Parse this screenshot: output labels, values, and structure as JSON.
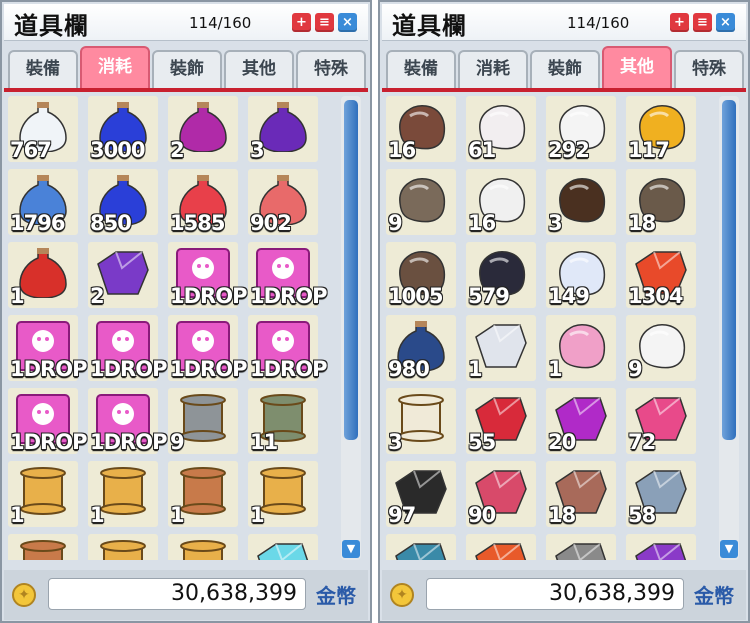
{
  "title": "道具欄",
  "capacity": "114/160",
  "buttons": {
    "add": "+",
    "menu": "≡",
    "close": "×",
    "scroll_down": "▼"
  },
  "tabs": [
    "裝備",
    "消耗",
    "裝飾",
    "其他",
    "特殊"
  ],
  "money": "30,638,399",
  "currency": "金幣",
  "left_active_tab": 1,
  "right_active_tab": 3,
  "left_items": [
    {
      "qty": "767",
      "icon": "white-potion",
      "color": "#f0f4f8"
    },
    {
      "qty": "3000",
      "icon": "blue-potion",
      "color": "#2a3fd8"
    },
    {
      "qty": "2",
      "icon": "purple-potion",
      "color": "#b02aa8"
    },
    {
      "qty": "3",
      "icon": "violet-potion",
      "color": "#6a2ab8"
    },
    {
      "qty": "1796",
      "icon": "blue-elixir",
      "color": "#4a82d8"
    },
    {
      "qty": "850",
      "icon": "blue-elixir",
      "color": "#2a3fd8"
    },
    {
      "qty": "1585",
      "icon": "red-elixir",
      "color": "#e8404a"
    },
    {
      "qty": "902",
      "icon": "red-elixir",
      "color": "#e86a6a"
    },
    {
      "qty": "1",
      "icon": "red-vial",
      "color": "#d8302a"
    },
    {
      "qty": "2",
      "icon": "crystal-orb",
      "color": "#7a3ac8"
    },
    {
      "qty": "1DROP",
      "icon": "drop-card",
      "color": "#e85ac8"
    },
    {
      "qty": "1DROP",
      "icon": "drop-card",
      "color": "#e85ac8"
    },
    {
      "qty": "1DROP",
      "icon": "drop-card",
      "color": "#e85ac8"
    },
    {
      "qty": "1DROP",
      "icon": "drop-card",
      "color": "#e85ac8"
    },
    {
      "qty": "1DROP",
      "icon": "drop-card",
      "color": "#e85ac8"
    },
    {
      "qty": "1DROP",
      "icon": "drop-card",
      "color": "#e85ac8"
    },
    {
      "qty": "1DROP",
      "icon": "drop-card",
      "color": "#e85ac8"
    },
    {
      "qty": "1DROP",
      "icon": "drop-card",
      "color": "#e85ac8"
    },
    {
      "qty": "9",
      "icon": "gray-map",
      "color": "#8e9498"
    },
    {
      "qty": "11",
      "icon": "green-map",
      "color": "#7e8e6e"
    },
    {
      "qty": "1",
      "icon": "scroll",
      "color": "#e8b04a"
    },
    {
      "qty": "1",
      "icon": "scroll",
      "color": "#e8b04a"
    },
    {
      "qty": "1",
      "icon": "brown-scroll",
      "color": "#c87a4a"
    },
    {
      "qty": "1",
      "icon": "scroll",
      "color": "#e8b04a"
    },
    {
      "qty": "",
      "icon": "brown-scroll",
      "color": "#c87a4a"
    },
    {
      "qty": "",
      "icon": "scroll",
      "color": "#e8b04a"
    },
    {
      "qty": "",
      "icon": "scroll",
      "color": "#e8b04a"
    },
    {
      "qty": "",
      "icon": "blue-gem",
      "color": "#6ad8e8"
    }
  ],
  "right_items": [
    {
      "qty": "16",
      "icon": "brown-leather",
      "color": "#7a4a3a"
    },
    {
      "qty": "61",
      "icon": "white-feather",
      "color": "#f2eef0"
    },
    {
      "qty": "292",
      "icon": "white-wool",
      "color": "#f4f4f4"
    },
    {
      "qty": "117",
      "icon": "gold-shell",
      "color": "#f0b020"
    },
    {
      "qty": "9",
      "icon": "fur-pelt",
      "color": "#7a6a5a"
    },
    {
      "qty": "16",
      "icon": "white-fur",
      "color": "#f0f0f0"
    },
    {
      "qty": "3",
      "icon": "dark-horn",
      "color": "#4a3020"
    },
    {
      "qty": "18",
      "icon": "wood-shard",
      "color": "#6a5a4a"
    },
    {
      "qty": "1005",
      "icon": "brown-hood",
      "color": "#6a5040"
    },
    {
      "qty": "579",
      "icon": "black-wing",
      "color": "#2a2a3a"
    },
    {
      "qty": "149",
      "icon": "white-cloth",
      "color": "#e0e8f8"
    },
    {
      "qty": "1304",
      "icon": "red-ore",
      "color": "#e84a2a"
    },
    {
      "qty": "980",
      "icon": "blue-bottle",
      "color": "#2a4a8a"
    },
    {
      "qty": "1",
      "icon": "silver-bar",
      "color": "#e0e4ec"
    },
    {
      "qty": "1",
      "icon": "pink-petal",
      "color": "#f0a0c8"
    },
    {
      "qty": "9",
      "icon": "white-quill",
      "color": "#f4f4f4"
    },
    {
      "qty": "3",
      "icon": "paper-roll",
      "color": "#f0ead8"
    },
    {
      "qty": "55",
      "icon": "red-crystal",
      "color": "#d82a3a"
    },
    {
      "qty": "20",
      "icon": "purple-crystal",
      "color": "#b02ac8"
    },
    {
      "qty": "72",
      "icon": "pink-crystal",
      "color": "#e84a8a"
    },
    {
      "qty": "97",
      "icon": "coal",
      "color": "#2a2a2a"
    },
    {
      "qty": "90",
      "icon": "gem-cluster",
      "color": "#d84a6a"
    },
    {
      "qty": "18",
      "icon": "copper-ore",
      "color": "#a86a5a"
    },
    {
      "qty": "58",
      "icon": "silver-ore",
      "color": "#8aa0b8"
    },
    {
      "qty": "",
      "icon": "teal-gem",
      "color": "#3a8aa8"
    },
    {
      "qty": "",
      "icon": "orange-gem",
      "color": "#e85a2a"
    },
    {
      "qty": "",
      "icon": "gray-ore",
      "color": "#8a8a8a"
    },
    {
      "qty": "",
      "icon": "purple-gem",
      "color": "#8a3ac8"
    }
  ]
}
